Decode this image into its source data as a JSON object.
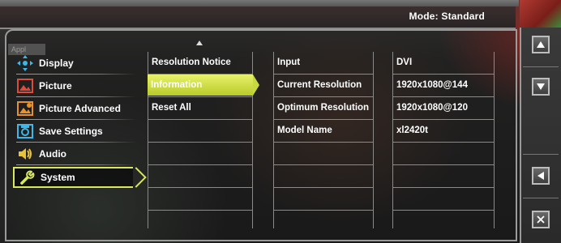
{
  "header": {
    "mode_label": "Mode: Standard"
  },
  "ghost_label": "Appl",
  "main_menu": {
    "items": [
      {
        "label": "Display",
        "icon": "display-icon"
      },
      {
        "label": "Picture",
        "icon": "picture-icon"
      },
      {
        "label": "Picture Advanced",
        "icon": "picture-advanced-icon"
      },
      {
        "label": "Save Settings",
        "icon": "save-settings-icon"
      },
      {
        "label": "Audio",
        "icon": "audio-icon"
      },
      {
        "label": "System",
        "icon": "wrench-icon",
        "selected": true
      }
    ]
  },
  "submenu": {
    "items": [
      {
        "label": "Resolution Notice"
      },
      {
        "label": "Information",
        "selected": true
      },
      {
        "label": "Reset All"
      }
    ]
  },
  "info": {
    "rows": [
      {
        "label": "Input",
        "value": "DVI"
      },
      {
        "label": "Current Resolution",
        "value": "1920x1080@144"
      },
      {
        "label": "Optimum Resolution",
        "value": "1920x1080@120"
      },
      {
        "label": "Model Name",
        "value": "xl2420t"
      }
    ]
  },
  "controls": [
    {
      "icon": "up-arrow-icon"
    },
    {
      "icon": "down-arrow-icon"
    },
    {
      "icon": "back-arrow-icon"
    },
    {
      "icon": "close-icon"
    }
  ],
  "colors": {
    "accent_highlight": "#d8e85a",
    "text": "#ffffff",
    "border": "#8a8a8a"
  }
}
